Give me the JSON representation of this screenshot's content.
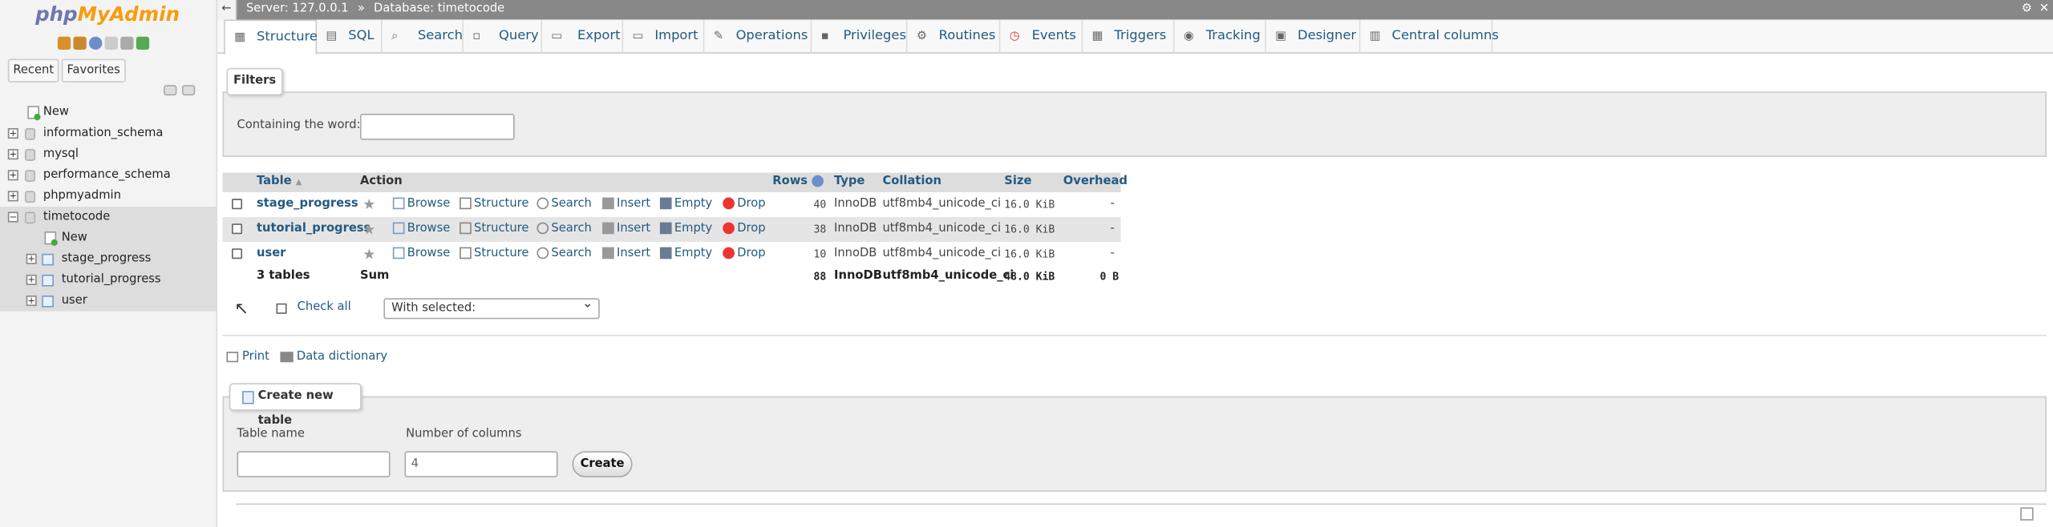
{
  "sidebar": {
    "logo": {
      "php": "php",
      "myadmin": "MyAdmin"
    },
    "recent": "Recent",
    "favorites": "Favorites",
    "tree": [
      {
        "label": "New"
      },
      {
        "label": "information_schema"
      },
      {
        "label": "mysql"
      },
      {
        "label": "performance_schema"
      },
      {
        "label": "phpmyadmin"
      },
      {
        "label": "timetocode"
      },
      {
        "label": "New"
      },
      {
        "label": "stage_progress"
      },
      {
        "label": "tutorial_progress"
      },
      {
        "label": "user"
      }
    ]
  },
  "breadcrumb": {
    "server": "Server: 127.0.0.1",
    "sep": "»",
    "database": "Database: timetocode"
  },
  "tabs": [
    {
      "label": "Structure",
      "icon": "structure-icon"
    },
    {
      "label": "SQL",
      "icon": "sql-icon"
    },
    {
      "label": "Search",
      "icon": "search-icon"
    },
    {
      "label": "Query",
      "icon": "query-icon"
    },
    {
      "label": "Export",
      "icon": "export-icon"
    },
    {
      "label": "Import",
      "icon": "import-icon"
    },
    {
      "label": "Operations",
      "icon": "wrench-icon"
    },
    {
      "label": "Privileges",
      "icon": "privileges-icon"
    },
    {
      "label": "Routines",
      "icon": "routines-icon"
    },
    {
      "label": "Events",
      "icon": "clock-icon"
    },
    {
      "label": "Triggers",
      "icon": "triggers-icon"
    },
    {
      "label": "Tracking",
      "icon": "eye-icon"
    },
    {
      "label": "Designer",
      "icon": "designer-icon"
    },
    {
      "label": "Central columns",
      "icon": "columns-icon"
    }
  ],
  "filters": {
    "legend": "Filters",
    "label": "Containing the word:",
    "value": ""
  },
  "table": {
    "headers": {
      "table": "Table",
      "sort": "▲",
      "action": "Action",
      "rows": "Rows",
      "type": "Type",
      "collation": "Collation",
      "size": "Size",
      "overhead": "Overhead"
    },
    "actions": {
      "browse": "Browse",
      "structure": "Structure",
      "search": "Search",
      "insert": "Insert",
      "empty": "Empty",
      "drop": "Drop"
    },
    "rows": [
      {
        "name": "stage_progress",
        "rows": "40",
        "type": "InnoDB",
        "collation": "utf8mb4_unicode_ci",
        "size": "16.0 KiB",
        "overhead": "-"
      },
      {
        "name": "tutorial_progress",
        "rows": "38",
        "type": "InnoDB",
        "collation": "utf8mb4_unicode_ci",
        "size": "16.0 KiB",
        "overhead": "-"
      },
      {
        "name": "user",
        "rows": "10",
        "type": "InnoDB",
        "collation": "utf8mb4_unicode_ci",
        "size": "16.0 KiB",
        "overhead": "-"
      }
    ],
    "totals": {
      "name": "3 tables",
      "action": "Sum",
      "rows": "88",
      "type": "InnoDB",
      "collation": "utf8mb4_unicode_ci",
      "size": "48.0 KiB",
      "overhead": "0 B"
    }
  },
  "bulk": {
    "check_all": "Check all",
    "with_selected": "With selected:"
  },
  "links": {
    "print": "Print",
    "data_dictionary": "Data dictionary"
  },
  "create_table": {
    "legend": "Create new table",
    "table_name_label": "Table name",
    "table_name_value": "",
    "num_columns_label": "Number of columns",
    "num_columns_value": "4",
    "create_button": "Create"
  },
  "colors": {
    "link": "#235a81",
    "logo_php": "#6c78af",
    "logo_admin": "#f89c0e"
  }
}
